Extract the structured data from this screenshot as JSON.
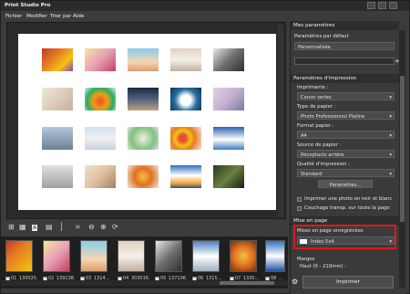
{
  "window": {
    "title": "Print Studio Pro"
  },
  "menu": {
    "items": [
      "Fichier",
      "Modifier",
      "Trier par",
      "Aide"
    ]
  },
  "filmstrip": {
    "items": [
      {
        "label": "01_130025...",
        "checked": true
      },
      {
        "label": "02_139138...",
        "checked": true
      },
      {
        "label": "03_1314...",
        "checked": true
      },
      {
        "label": "04_303016...",
        "checked": true
      },
      {
        "label": "05_137106...",
        "checked": true
      },
      {
        "label": "06_1315...",
        "checked": true
      },
      {
        "label": "07_1330...",
        "checked": true
      },
      {
        "label": "08_...",
        "checked": true
      }
    ]
  },
  "panel": {
    "my_settings": "Mes paramètres",
    "default_settings": "Paramètres par défaut",
    "custom": "Personnalisée",
    "print_settings_header": "Paramètres d'impression",
    "printer_label": "Imprimante :",
    "printer_value": "Canon              series",
    "paper_type_label": "Type de papier :",
    "paper_type_value": "Photo Professionnel Platine",
    "paper_format_label": "Format papier :",
    "paper_format_value": "A4",
    "paper_source_label": "Source de papier :",
    "paper_source_value": "Réceptacle arrière",
    "print_quality_label": "Qualité d'impression :",
    "print_quality_value": "Standard",
    "print_options_button": "Paramètres...",
    "bw_checkbox": "Imprimer une photo en noir et blanc",
    "coating_checkbox": "Couchage transp. sur toute la page",
    "layout_header": "Mise en page",
    "saved_layouts_label": "Mises en page enregistrées",
    "saved_layout_value": "Index 5x4",
    "margins_label": "Marges",
    "top_margin_label": "Haut (0 - 210mm) :",
    "print_button": "Imprimer"
  },
  "colors": {
    "highlight": "#e01818",
    "panel": "#3a3a3a",
    "window": "#3c3c3c"
  },
  "icons": [
    "settings-gear-icon",
    "grid-icon",
    "crop-icon",
    "zoom-out-icon",
    "zoom-in-icon",
    "rotate-icon",
    "scroll-down-icon"
  ]
}
